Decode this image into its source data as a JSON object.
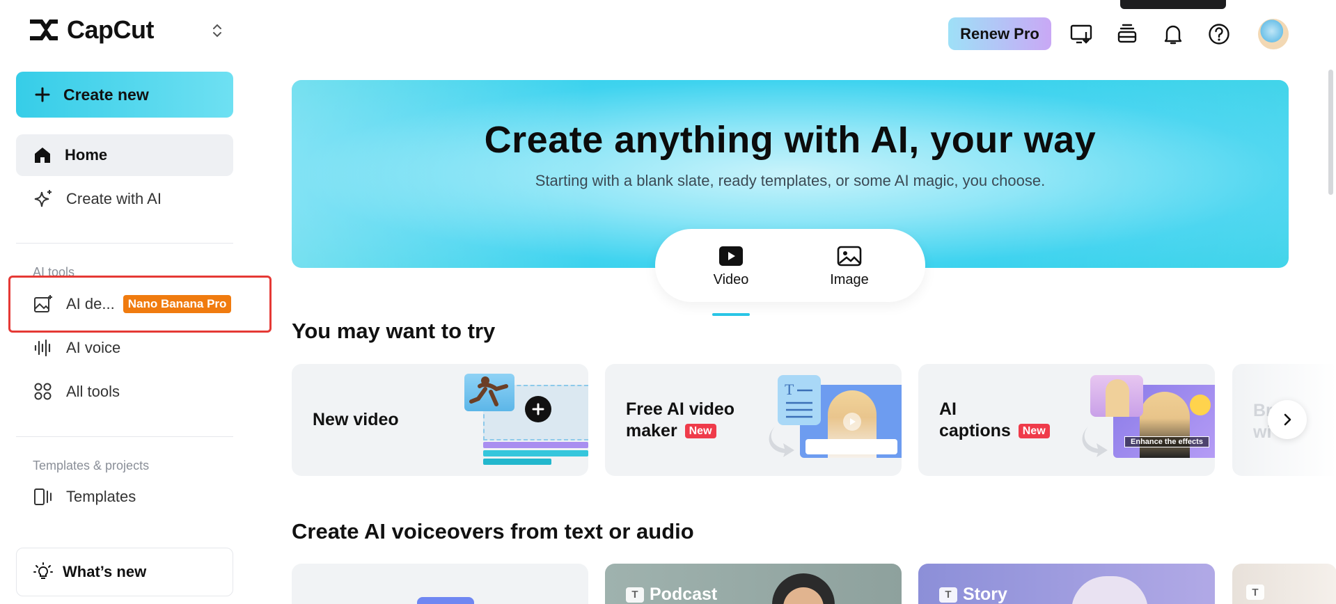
{
  "app": {
    "logo_text": "CapCut"
  },
  "sidebar": {
    "create_new_label": "Create new",
    "items": [
      {
        "label": "Home",
        "icon": "home-icon"
      },
      {
        "label": "Create with AI",
        "icon": "sparkle-icon"
      }
    ],
    "ai_tools_title": "AI tools",
    "ai_tools": [
      {
        "label": "AI de...",
        "badge": "Nano Banana Pro",
        "icon": "ai-image-icon"
      },
      {
        "label": "AI voice",
        "icon": "voice-wave-icon"
      },
      {
        "label": "All tools",
        "icon": "grid-icon"
      }
    ],
    "templates_title": "Templates & projects",
    "templates_item": "Templates",
    "whats_new_label": "What’s new"
  },
  "topbar": {
    "renew_label": "Renew Pro"
  },
  "hero": {
    "title": "Create anything with AI, your way",
    "subtitle": "Starting with a blank slate, ready templates, or some AI magic, you choose.",
    "tabs": [
      {
        "label": "Video",
        "active": true
      },
      {
        "label": "Image",
        "active": false
      }
    ]
  },
  "try_section": {
    "heading": "You may want to try",
    "cards": [
      {
        "title_line1": "New video",
        "title_line2": "",
        "badge": ""
      },
      {
        "title_line1": "Free AI video",
        "title_line2": "maker",
        "badge": "New"
      },
      {
        "title_line1": "AI",
        "title_line2": "captions",
        "badge": "New",
        "overlay_text": "Enhance the effects"
      }
    ],
    "partial_card_text_line1": "Br",
    "partial_card_text_line2": "wi"
  },
  "voice_section": {
    "heading": "Create AI voiceovers from text or audio",
    "cards": [
      {
        "label": ""
      },
      {
        "label": "Podcast"
      },
      {
        "label": "Story"
      }
    ]
  },
  "colors": {
    "accent": "#29c5e6",
    "badge_orange": "#f07b0f",
    "new_badge": "#ef3b4a",
    "highlight": "#e53935"
  }
}
